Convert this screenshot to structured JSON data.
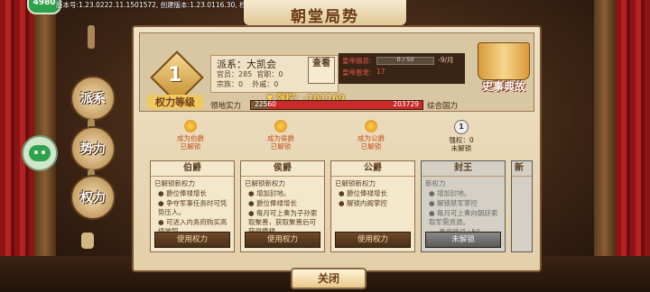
{
  "header": {
    "version_text": "版本号:1.23.0222.11.1501572, 创建版本:1.23.0116.30, 档位:云端存档",
    "top_badge": "4980",
    "title": "朝堂局势"
  },
  "side_nav": {
    "items": [
      {
        "label": "派系"
      },
      {
        "label": "势力"
      },
      {
        "label": "权力"
      }
    ]
  },
  "info": {
    "rank_number": "1",
    "rank_label": "权力等级",
    "faction_name": "派系：大凯会",
    "rows": [
      {
        "a": "官员：285",
        "b": "官职：0"
      },
      {
        "a": "宗族：0",
        "b": "外戚：0"
      }
    ],
    "check_btn": "查看",
    "stats": {
      "favor_label": "皇帝猜忌:",
      "favor_bar_text": "0 / 50",
      "favor_right": "-9/月",
      "grace_label": "皇帝恩宠:",
      "grace_value": "17"
    },
    "book_label": "史事典故",
    "power_label": "▼ 强权：-181169",
    "bar_left_label": "领地实力",
    "bar_left_value": "22560",
    "bar_right_value": "203729",
    "bar_fill_fraction": 0.1,
    "bar_right_label": "综合国力"
  },
  "ranks": [
    {
      "head1": "成为伯爵",
      "head2": "已解锁",
      "title": "伯爵",
      "sub": "已解锁新权力",
      "items": [
        "爵位俸禄增长",
        "争夺军事任务时可凭势压人。",
        "可进入内务府购买高级地契"
      ],
      "btn": "使用权力"
    },
    {
      "head1": "成为侯爵",
      "head2": "已解锁",
      "title": "侯爵",
      "sub": "已解锁新权力",
      "items": [
        "增加封地。",
        "爵位俸禄增长",
        "每月可上奏为子孙索取聚善，获取聚善后可获得俸禄。"
      ],
      "btn": "使用权力"
    },
    {
      "head1": "成为公爵",
      "head2": "已解锁",
      "title": "公爵",
      "sub": "已解锁新权力",
      "items": [
        "爵位俸禄增长",
        "解锁内阁掌控"
      ],
      "btn": "使用权力"
    },
    {
      "head0": "1",
      "head1": "强权：0",
      "head2": "未解锁",
      "title": "封王",
      "sub": "新权力",
      "items": [
        "增加封地。",
        "解锁禁军掌控",
        "每月可上奏向朝廷索取军需资源。",
        "皇帝猜忌+50"
      ],
      "btn": "未解锁"
    }
  ],
  "partial_card_title": "新",
  "close_button": "关闭",
  "colors": {
    "accent": "#c92a2a",
    "gold": "#ffd24a",
    "panel": "#efe2c6"
  }
}
